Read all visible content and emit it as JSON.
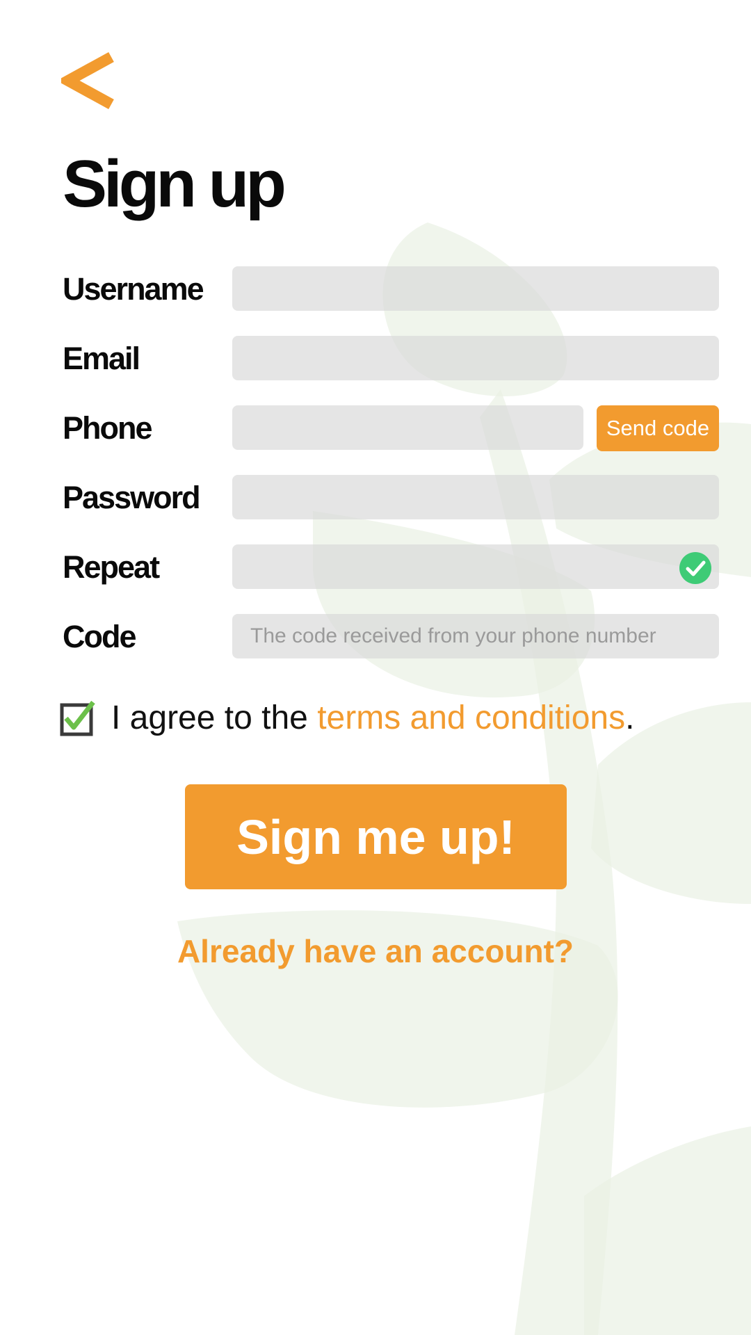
{
  "colors": {
    "accent": "#f29b2f",
    "success": "#3ecb76",
    "field_bg": "#e3e3e3",
    "text": "#0a0a0a",
    "leaf": "#eef4ea"
  },
  "nav": {
    "back_icon": "chevron-left-icon"
  },
  "page": {
    "title": "Sign up"
  },
  "form": {
    "username": {
      "label": "Username",
      "value": "",
      "placeholder": ""
    },
    "email": {
      "label": "Email",
      "value": "",
      "placeholder": ""
    },
    "phone": {
      "label": "Phone",
      "value": "",
      "placeholder": "",
      "send_code_label": "Send code"
    },
    "password": {
      "label": "Password",
      "value": "",
      "placeholder": ""
    },
    "repeat": {
      "label": "Repeat",
      "value": "",
      "placeholder": "",
      "status_icon": "check-circle-icon"
    },
    "code": {
      "label": "Code",
      "value": "",
      "placeholder": "The code received from your phone number"
    }
  },
  "agreement": {
    "checked": true,
    "prefix": "I agree to the ",
    "link_text": "terms and conditions",
    "suffix": "."
  },
  "actions": {
    "submit_label": "Sign me up!",
    "login_link": "Already have an account?"
  }
}
